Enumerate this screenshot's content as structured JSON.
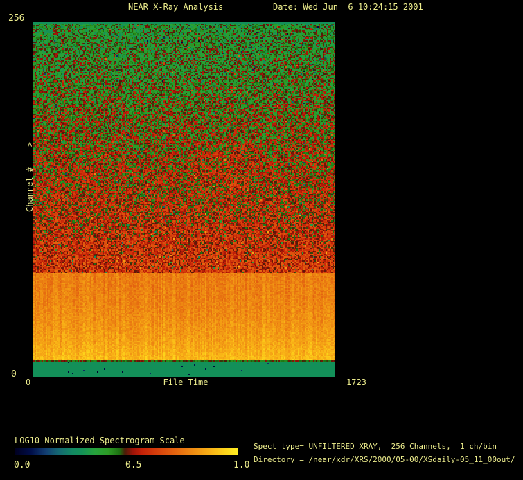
{
  "window": {
    "bg": "#000000",
    "text_color": "#ecec8c"
  },
  "header": {
    "title": "NEAR X-Ray Analysis",
    "date_label": "Date: Wed Jun  6 10:24:15 2001"
  },
  "plot": {
    "ylabel": "Channel # --->",
    "xlabel": "File Time",
    "y_max_label": "256",
    "y_min_label": "0",
    "x_min_label": "0",
    "x_max_label": "1723"
  },
  "colorbar": {
    "label": "LOG10 Normalized Spectrogram Scale",
    "tick_labels": [
      "0.0",
      "0.5",
      "1.0"
    ]
  },
  "footer": {
    "spect_line": "Spect type= UNFILTERED XRAY,  256 Channels,  1 ch/bin",
    "directory_line": "Directory = /near/xdr/XRS/2000/05-00/XSdaily-05_11_00out/"
  },
  "chart_data": {
    "type": "heatmap",
    "title": "NEAR X-Ray Analysis",
    "xlabel": "File Time",
    "ylabel": "Channel # --->",
    "x_range": [
      0,
      1723
    ],
    "y_range": [
      0,
      256
    ],
    "value_scale": {
      "label": "LOG10 Normalized Spectrogram Scale",
      "range": [
        0.0,
        1.0
      ],
      "mid_tick": 0.5
    },
    "legend_position": "bottom-left",
    "grid": false,
    "colormap": [
      [
        0.0,
        "#000020"
      ],
      [
        0.07,
        "#000d48"
      ],
      [
        0.14,
        "#123e72"
      ],
      [
        0.2,
        "#156a72"
      ],
      [
        0.26,
        "#128a62"
      ],
      [
        0.3,
        "#149158"
      ],
      [
        0.36,
        "#27a33c"
      ],
      [
        0.42,
        "#2e9b26"
      ],
      [
        0.47,
        "#1d7212"
      ],
      [
        0.495,
        "#4a1c08"
      ],
      [
        0.53,
        "#9c1408"
      ],
      [
        0.57,
        "#c42108"
      ],
      [
        0.64,
        "#d6400c"
      ],
      [
        0.72,
        "#e46410"
      ],
      [
        0.8,
        "#ef8c13"
      ],
      [
        0.88,
        "#f9b317"
      ],
      [
        0.94,
        "#fdd21b"
      ],
      [
        1.0,
        "#ffec22"
      ]
    ],
    "bands": [
      {
        "name": "top-edge-line",
        "channels": [
          255,
          256
        ],
        "value_top": 0.295,
        "value_bottom": 0.295,
        "noise": 0,
        "col_noise": 0,
        "ease": 1
      },
      {
        "name": "upper-gradient",
        "channels": [
          75,
          255
        ],
        "value_top": 0.4,
        "value_bottom": 0.615,
        "noise": 0.125,
        "col_noise": 0.012,
        "ease": 1,
        "dark_speckle": 0.02,
        "bright_speckle": 0.01,
        "description": "noisy green at top (high channels) fading through mixed green/red into solid red toward channel 75"
      },
      {
        "name": "bright-band",
        "channels": [
          12,
          75
        ],
        "value_top": 0.775,
        "value_bottom": 0.895,
        "noise": 0.04,
        "col_noise": 0.032,
        "ease": 2.0,
        "description": "high-intensity orange band brightening to yellow at low channels, with vertical striping"
      },
      {
        "name": "dark-line",
        "channels": [
          11,
          12
        ],
        "value_top": 0.48,
        "value_bottom": 0.48,
        "noise": 0.05,
        "col_noise": 0,
        "ease": 1,
        "description": "thin dark olive separator row"
      },
      {
        "name": "bottom-strip",
        "channels": [
          0,
          11
        ],
        "value_top": 0.295,
        "value_bottom": 0.295,
        "noise": 0,
        "col_noise": 0,
        "ease": 1,
        "dark_speckle": 0.005,
        "description": "solid teal strip at lowest channels"
      }
    ],
    "features": [
      {
        "name": "bright-blob",
        "x_frac": [
          0.532,
          0.728
        ],
        "channels": [
          137,
          169
        ],
        "dv": 0.03
      },
      {
        "name": "vertical-line-dark",
        "x_frac": [
          0.757,
          0.762
        ],
        "channels": [
          75,
          230
        ],
        "dv": -0.022
      },
      {
        "name": "vertical-line-bright",
        "x_frac": [
          0.757,
          0.762
        ],
        "channels": [
          12,
          75
        ],
        "dv": 0.045
      }
    ]
  }
}
